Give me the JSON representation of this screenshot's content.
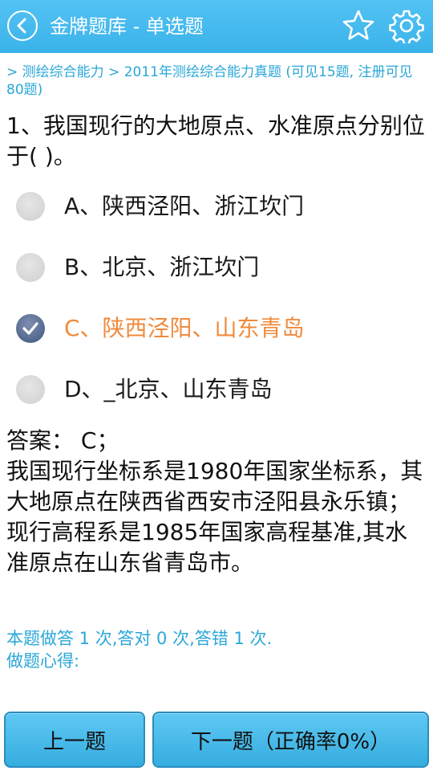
{
  "header": {
    "title": "金牌题库 - 单选题",
    "back_icon": "chevron-left-circle-icon",
    "favorite_icon": "star-outline-icon",
    "settings_icon": "gear-icon",
    "bar_color": "#3ab3ea"
  },
  "breadcrumb": "> 测绘综合能力 > 2011年测绘综合能力真题 (可见15题, 注册可见80题)",
  "question": {
    "text": "1、我国现行的大地原点、水准原点分别位于( )。"
  },
  "options": [
    {
      "label": "A、陕西泾阳、浙江坎门",
      "selected": false
    },
    {
      "label": "B、北京、浙江坎门",
      "selected": false
    },
    {
      "label": "C、陕西泾阳、山东青岛",
      "selected": true
    },
    {
      "label": "D、_北京、山东青岛",
      "selected": false
    }
  ],
  "answer": {
    "line": "答案： C；",
    "explanation": "我国现行坐标系是1980年国家坐标系，其大地原点在陕西省西安市泾阳县永乐镇；现行高程系是1985年国家高程基准,其水准原点在山东省青岛市。"
  },
  "stats": {
    "summary": "本题做答 1 次,答对 0 次,答错 1 次.",
    "notes_label": "做题心得:"
  },
  "footer": {
    "prev_label": "上一题",
    "next_label": "下一题（正确率0%）"
  },
  "colors": {
    "accent": "#2aa7d8",
    "selected_option": "#f08a3c"
  }
}
